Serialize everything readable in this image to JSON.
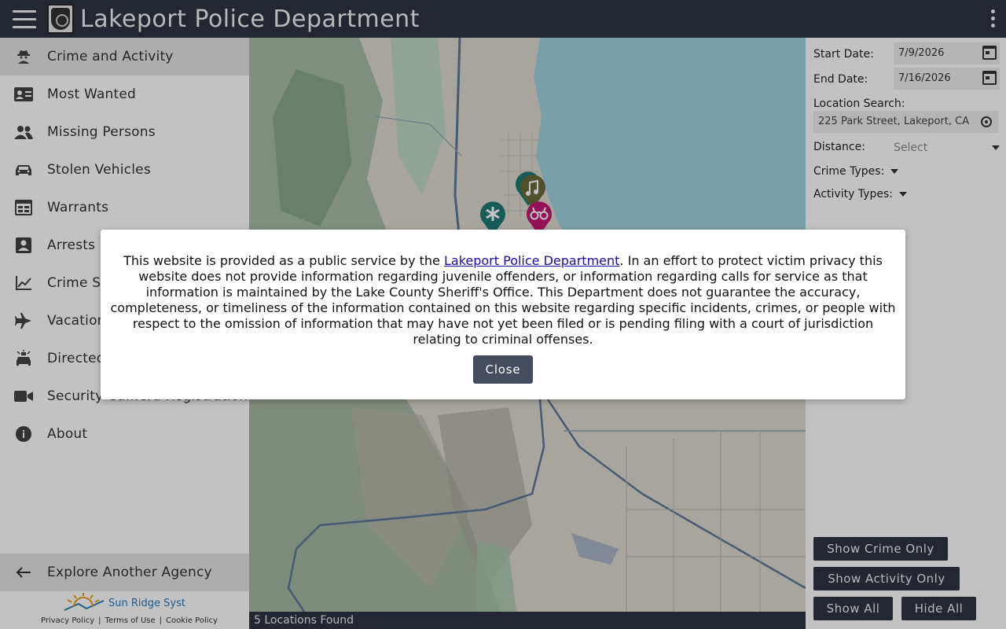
{
  "header": {
    "title": "Lakeport Police Department",
    "logo_icon": "police-badge-logo"
  },
  "sidebar": {
    "items": [
      {
        "label": "Crime and Activity",
        "icon": "detective-icon",
        "active": true
      },
      {
        "label": "Most Wanted",
        "icon": "id-card-icon"
      },
      {
        "label": "Missing Persons",
        "icon": "people-icon"
      },
      {
        "label": "Stolen Vehicles",
        "icon": "car-icon"
      },
      {
        "label": "Warrants",
        "icon": "calendar-grid-icon"
      },
      {
        "label": "Arrests",
        "icon": "person-box-icon"
      },
      {
        "label": "Crime Statistics",
        "icon": "line-chart-icon"
      },
      {
        "label": "Vacation Home Check",
        "icon": "airplane-icon"
      },
      {
        "label": "Directed Patrol",
        "icon": "police-car-light-icon"
      },
      {
        "label": "Security Camera Registration",
        "icon": "video-camera-icon"
      },
      {
        "label": "About",
        "icon": "info-icon"
      }
    ],
    "explore_label": "Explore Another Agency",
    "footer": {
      "brand": "Sun Ridge Syst",
      "links": [
        "Privacy Policy",
        "Terms of Use",
        "Cookie Policy"
      ]
    }
  },
  "map": {
    "status": "5 Locations Found",
    "markers": [
      {
        "icon": "music-note-icon",
        "color": "#6b6a3a"
      },
      {
        "icon": "asterisk-icon",
        "color": "#1e7a73"
      },
      {
        "icon": "handcuffs-icon",
        "color": "#c2186e"
      }
    ]
  },
  "filters": {
    "start_date_label": "Start Date:",
    "start_date": "7/9/2026",
    "end_date_label": "End Date:",
    "end_date": "7/16/2026",
    "location_label": "Location Search:",
    "location_value": "225 Park Street, Lakeport, CA",
    "distance_label": "Distance:",
    "distance_placeholder": "Select",
    "crime_types_label": "Crime Types:",
    "activity_types_label": "Activity Types:"
  },
  "buttons": {
    "show_crime_only": "Show Crime Only",
    "show_activity_only": "Show Activity Only",
    "show_all": "Show All",
    "hide_all": "Hide All"
  },
  "modal": {
    "text_before": "This website is provided as a public service by the ",
    "link_text": "Lakeport Police Department",
    "text_after": ". In an effort to protect victim privacy this website does not provide information regarding juvenile offenders, or information regarding calls for service as that information is maintained by the Lake County Sheriff's Office. This Department does not guarantee the accuracy, completeness, or timeliness of the information contained on this website regarding specific incidents, crimes, or people with respect to the omission of information that may have not yet been filed or is pending filing with a court of jurisdiction relating to criminal offenses.",
    "close_label": "Close"
  },
  "colors": {
    "header_bg": "#2f3441",
    "lake": "#9fd3e0",
    "button_bg": "#2f3441"
  }
}
